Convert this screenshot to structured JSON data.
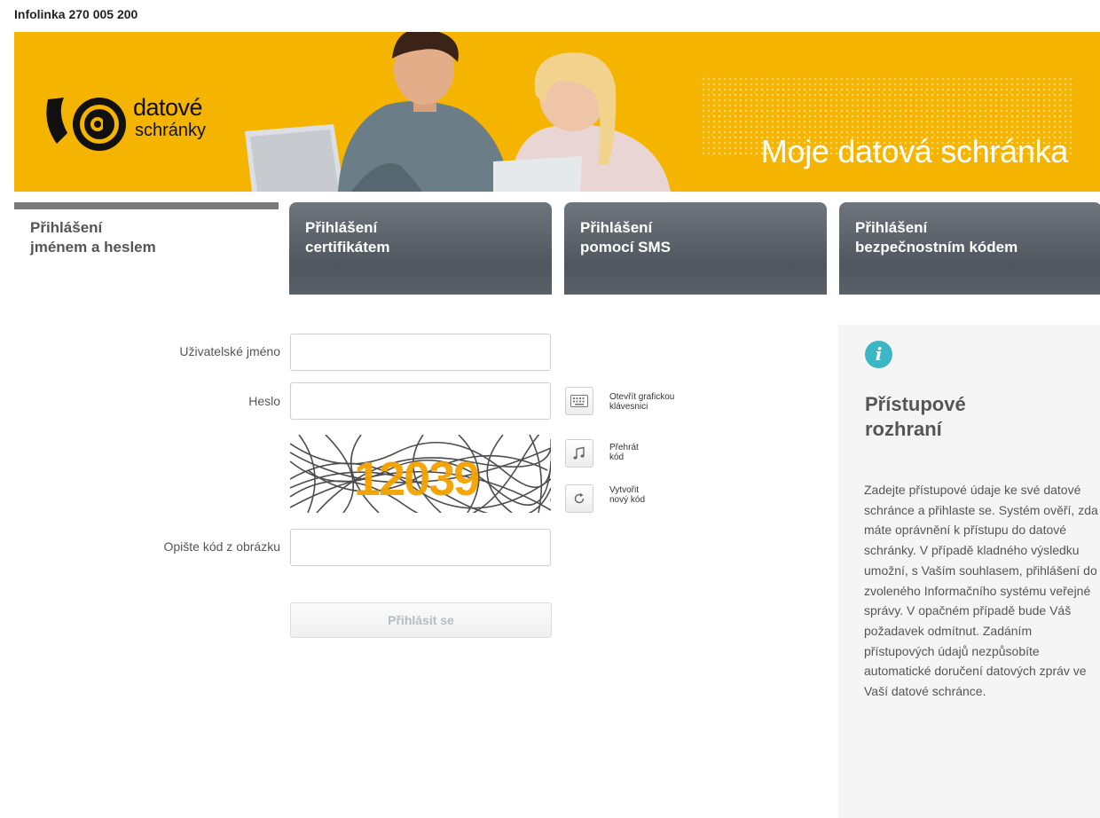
{
  "header": {
    "infoline": "Infolinka 270 005 200"
  },
  "banner": {
    "logo_line1": "datové",
    "logo_line2": "schránky",
    "title": "Moje datová schránka",
    "color": "#f5b400"
  },
  "tabs": [
    {
      "line1": "Přihlášení",
      "line2": "jménem a heslem",
      "active": true
    },
    {
      "line1": "Přihlášení",
      "line2": "certifikátem",
      "active": false
    },
    {
      "line1": "Přihlášení",
      "line2": "pomocí SMS",
      "active": false
    },
    {
      "line1": "Přihlášení",
      "line2": "bezpečnostním kódem",
      "active": false
    }
  ],
  "form": {
    "username_label": "Uživatelské jméno",
    "username_value": "",
    "password_label": "Heslo",
    "password_value": "",
    "keyboard_button_label": "Otevřít grafickou klávesnici",
    "keyboard_line1": "Otevřít grafickou",
    "keyboard_line2": "klávesnici",
    "play_line1": "Přehrát",
    "play_line2": "kód",
    "refresh_line1": "Vytvořit",
    "refresh_line2": "nový kód",
    "captcha_code": "12039",
    "captcha_label": "Opište kód z obrázku",
    "captcha_value": "",
    "submit_label": "Přihlásit se"
  },
  "info": {
    "icon": "info-icon",
    "icon_glyph": "i",
    "title_line1": "Přístupové",
    "title_line2": "rozhraní",
    "text": "Zadejte přístupové údaje ke své datové schránce a přihlaste se. Systém ověří, zda máte oprávnění k přístupu do datové schránky. V případě kladného výsledku umožní, s Vaším souhlasem, přihlášení do zvoleného Informačního systému veřejné správy. V opačném případě bude Váš požadavek odmítnut. Zadáním přístupových údajů nezpůsobíte automatické doručení datových zpráv ve Vaší datové schránce.",
    "accent": "#3bb6c4"
  }
}
